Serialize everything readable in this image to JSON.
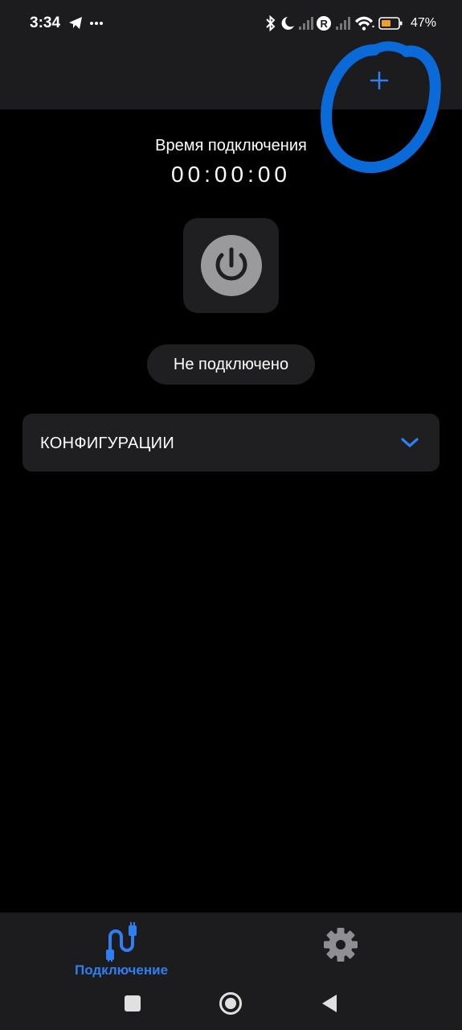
{
  "status_bar": {
    "time": "3:34",
    "battery_percent": "47%",
    "battery_level": 0.47,
    "icons": [
      "telegram-icon",
      "more-notifications-icon",
      "bluetooth-icon",
      "do-not-disturb-icon",
      "signal-icon",
      "roaming-icon",
      "signal-icon",
      "wifi-icon",
      "battery-icon"
    ]
  },
  "top_bar": {
    "add_icon": "plus-icon",
    "more_icon": "more-vert-icon",
    "highlight_color": "#0a6ad8"
  },
  "timer": {
    "label": "Время подключения",
    "value": "00:00:00"
  },
  "power": {
    "icon": "power-icon"
  },
  "connection_status": "Не подключено",
  "configurations": {
    "title": "КОНФИГУРАЦИИ",
    "icon": "chevron-down-icon"
  },
  "bottom_nav": {
    "items": [
      {
        "label": "Подключение",
        "icon": "connection-icon",
        "active": true
      },
      {
        "label": "",
        "icon": "gear-icon",
        "active": false
      }
    ]
  },
  "system_nav": {
    "icons": [
      "recents-square-icon",
      "home-circle-icon",
      "back-triangle-icon"
    ]
  },
  "colors": {
    "accent": "#2f7ff0",
    "background": "#000000",
    "bar": "#1c1c1e",
    "card": "#1f1f21"
  }
}
